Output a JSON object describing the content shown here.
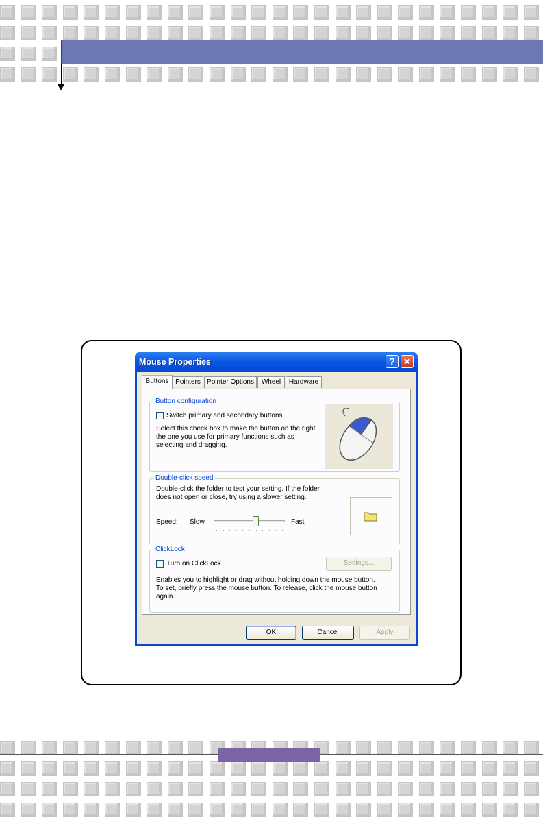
{
  "dialog": {
    "title": "Mouse Properties",
    "help_glyph": "?",
    "close_glyph": "✕",
    "tabs": [
      {
        "label": "Buttons"
      },
      {
        "label": "Pointers"
      },
      {
        "label": "Pointer Options"
      },
      {
        "label": "Wheel"
      },
      {
        "label": "Hardware"
      }
    ],
    "active_tab": "Buttons",
    "button_configuration": {
      "title": "Button configuration",
      "checkbox_label": "Switch primary and secondary buttons",
      "checked": false,
      "description_lines": [
        "Select this check box to make the button on the right",
        "the one you use for primary functions such as",
        "selecting and dragging."
      ]
    },
    "double_click_speed": {
      "title": "Double-click speed",
      "description_lines": [
        "Double-click the folder to test your setting. If the folder",
        "does not open or close, try using a slower setting."
      ],
      "speed_label": "Speed:",
      "slow_label": "Slow",
      "fast_label": "Fast",
      "slider_value": 0.6
    },
    "clicklock": {
      "title": "ClickLock",
      "checkbox_label": "Turn on ClickLock",
      "checked": false,
      "settings_button": "Settings...",
      "description_lines": [
        "Enables you to highlight or drag without holding down the mouse button.",
        "To set, briefly press the mouse button. To release, click the mouse button",
        "again."
      ]
    },
    "buttons": {
      "ok": "OK",
      "cancel": "Cancel",
      "apply": "Apply"
    }
  },
  "colors": {
    "header_bar": "#6b78b2",
    "footer_bar": "#7b65a6",
    "title_bar": "#0a58e4",
    "group_title": "#0046d5"
  }
}
